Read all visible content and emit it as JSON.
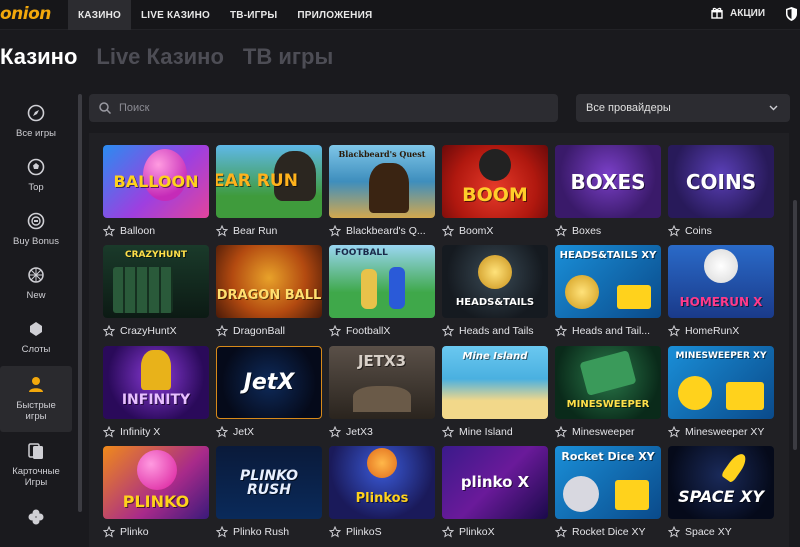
{
  "brand": {
    "logo_text": "onion"
  },
  "topnav": {
    "tabs": [
      {
        "label": "КАЗИНО",
        "active": true
      },
      {
        "label": "LIVE КАЗИНО",
        "active": false
      },
      {
        "label": "ТВ-ИГРЫ",
        "active": false
      },
      {
        "label": "ПРИЛОЖЕНИЯ",
        "active": false
      }
    ],
    "promo_label": "АКЦИИ",
    "promo_icon": "gift-icon",
    "shield_icon": "shield-icon"
  },
  "section_tabs": [
    {
      "label": "Казино",
      "active": true
    },
    {
      "label": "Live Казино",
      "active": false
    },
    {
      "label": "ТВ игры",
      "active": false
    }
  ],
  "sidebar": {
    "items": [
      {
        "label": "Все игры",
        "icon": "compass-icon"
      },
      {
        "label": "Top",
        "icon": "soccer-ball-icon"
      },
      {
        "label": "Buy Bonus",
        "icon": "coin-icon"
      },
      {
        "label": "New",
        "icon": "sparkle-icon"
      },
      {
        "label": "Слоты",
        "icon": "cherry-icon"
      },
      {
        "label": "Быстрые игры",
        "icon": "person-icon",
        "active": true
      },
      {
        "label": "Карточные Игры",
        "icon": "cards-icon"
      },
      {
        "label": "",
        "icon": "clover-icon"
      }
    ]
  },
  "search": {
    "placeholder": "Поиск",
    "icon": "search-icon"
  },
  "provider_filter": {
    "selected": "Все провайдеры",
    "icon": "chevron-down-icon"
  },
  "games": [
    {
      "name": "Balloon",
      "art": "BALLOON"
    },
    {
      "name": "Bear Run",
      "art": "BEAR RUN"
    },
    {
      "name": "Blackbeard's Q...",
      "art": "Blackbeard's Quest"
    },
    {
      "name": "BoomX",
      "art": "BOOM"
    },
    {
      "name": "Boxes",
      "art": "BOXES"
    },
    {
      "name": "Coins",
      "art": "COINS"
    },
    {
      "name": "CrazyHuntX",
      "art": "CRAZYHUNT"
    },
    {
      "name": "DragonBall",
      "art": "DRAGON BALL"
    },
    {
      "name": "FootballX",
      "art": "FOOTBALL"
    },
    {
      "name": "Heads and Tails",
      "art": "HEADS&TAILS"
    },
    {
      "name": "Heads and Tail...",
      "art": "HEADS&TAILS XY"
    },
    {
      "name": "HomeRunX",
      "art": "HOMERUN X"
    },
    {
      "name": "Infinity X",
      "art": "INFINITY"
    },
    {
      "name": "JetX",
      "art": "JetX"
    },
    {
      "name": "JetX3",
      "art": "JETX3"
    },
    {
      "name": "Mine Island",
      "art": "Mine Island"
    },
    {
      "name": "Minesweeper",
      "art": "MINESWEEPER"
    },
    {
      "name": "Minesweeper XY",
      "art": "MINESWEEPER XY"
    },
    {
      "name": "Plinko",
      "art": "PLINKO"
    },
    {
      "name": "Plinko Rush",
      "art": "PLINKO RUSH"
    },
    {
      "name": "PlinkoS",
      "art": "Plinkos"
    },
    {
      "name": "PlinkoX",
      "art": "plinko X"
    },
    {
      "name": "Rocket Dice XY",
      "art": "Rocket Dice XY"
    },
    {
      "name": "Space XY",
      "art": "SPACE XY"
    }
  ],
  "colors": {
    "accent": "#f2a80c",
    "background": "#1a1a1e",
    "panel": "#202024"
  }
}
